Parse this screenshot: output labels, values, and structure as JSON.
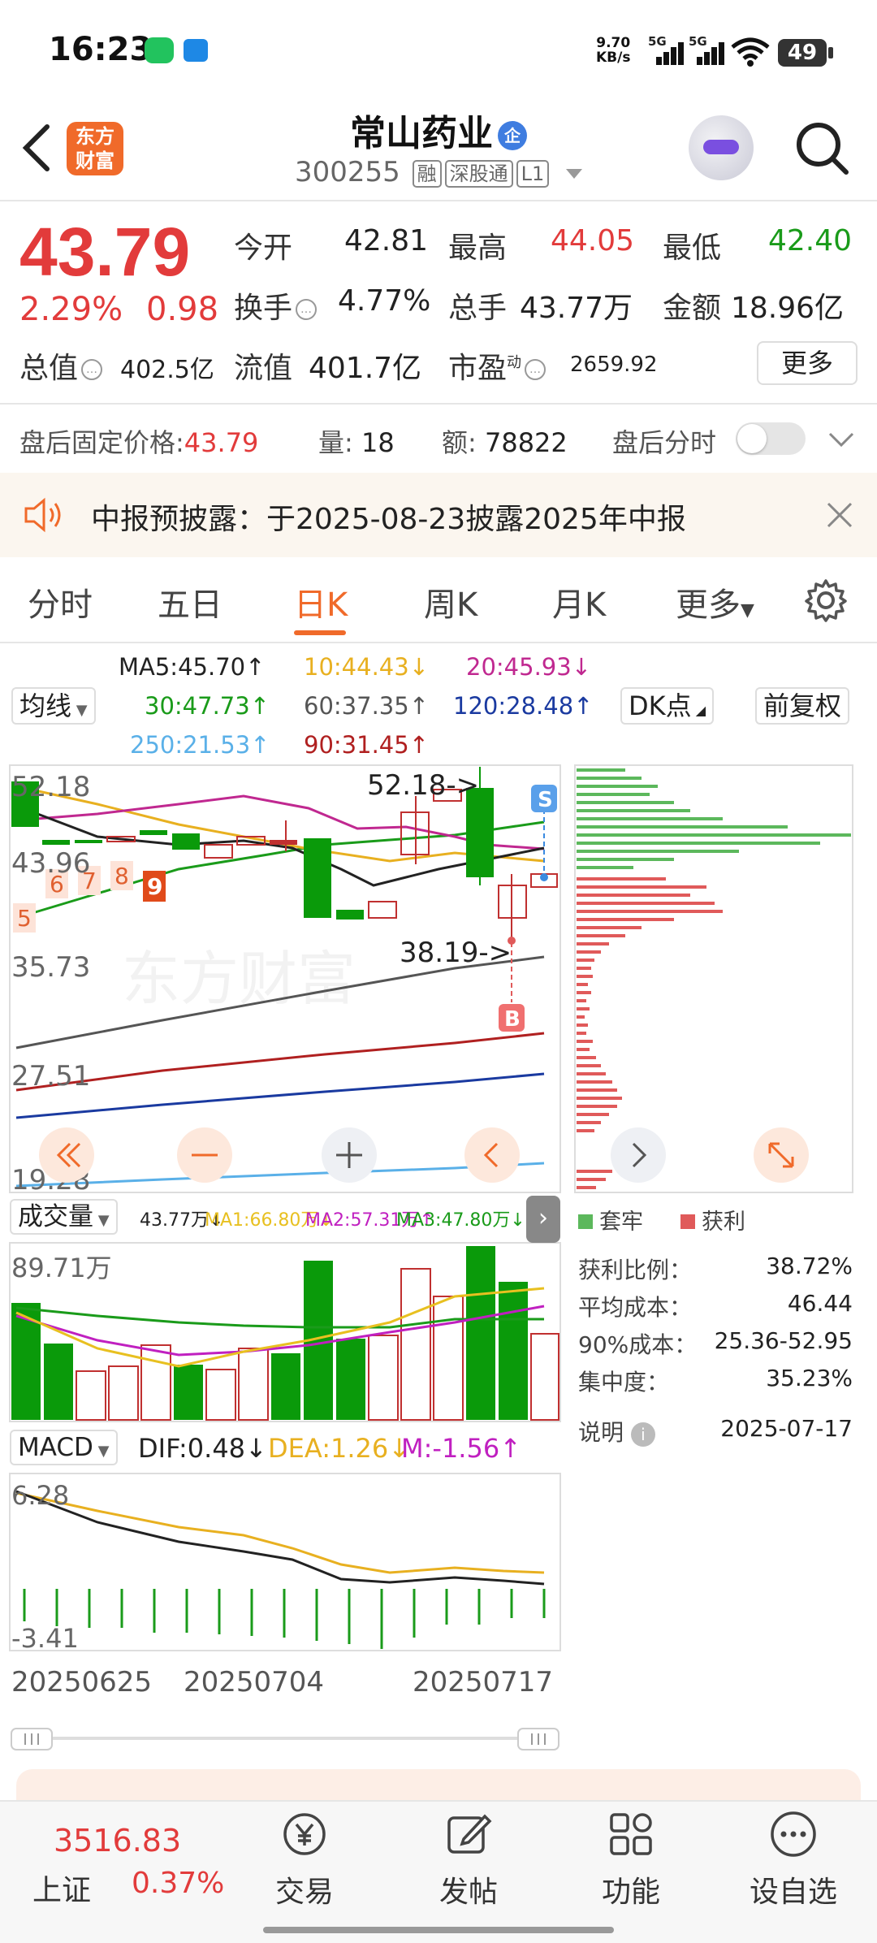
{
  "status_bar": {
    "time": "16:23",
    "net_speed_value": "9.70",
    "net_speed_unit": "KB/s",
    "sim1": "5G",
    "sim2": "5G",
    "battery": "49"
  },
  "header": {
    "logo_text_line1": "东方",
    "logo_text_line2": "财富",
    "stock_name": "常山药业",
    "name_badge": "企",
    "stock_code": "300255",
    "tags": [
      "融",
      "深股通",
      "L1"
    ]
  },
  "quote": {
    "price": "43.79",
    "change_pct": "2.29%",
    "change_val": "0.98",
    "open_label": "今开",
    "open": "42.81",
    "high_label": "最高",
    "high": "44.05",
    "low_label": "最低",
    "low": "42.40",
    "turnover_label": "换手",
    "turnover": "4.77%",
    "volume_label": "总手",
    "volume": "43.77万",
    "amount_label": "金额",
    "amount": "18.96亿",
    "mktcap_label": "总值",
    "mktcap": "402.5亿",
    "float_label": "流值",
    "float": "401.7亿",
    "pe_label": "市盈",
    "pe_sup": "动",
    "pe": "2659.92",
    "more_button": "更多"
  },
  "after_hours": {
    "price_label": "盘后固定价格:",
    "price": "43.79",
    "qty_label": "量:",
    "qty": "18",
    "amt_label": "额:",
    "amt": "78822",
    "toggle_label": "盘后分时"
  },
  "notice": {
    "text": "中报预披露：于2025-08-23披露2025年中报"
  },
  "tabs": [
    "分时",
    "五日",
    "日K",
    "周K",
    "月K",
    "更多"
  ],
  "active_tab": "日K",
  "ma": {
    "selector": "均线",
    "ma5": "MA5:45.70↑",
    "ma10": "10:44.43↓",
    "ma20": "20:45.93↓",
    "ma30": "30:47.73↑",
    "ma60": "60:37.35↑",
    "ma120": "120:28.48↑",
    "ma250": "250:21.53↑",
    "ma90": "90:31.45↑",
    "dk_button": "DK点",
    "adjust_button": "前复权"
  },
  "kline": {
    "y_labels": [
      "52.18",
      "43.96",
      "35.73",
      "27.51",
      "19.28"
    ],
    "high_note": "52.18->",
    "low_note": "38.19->",
    "sell_marker": "S",
    "buy_marker": "B",
    "td_counts": [
      "5",
      "6",
      "7",
      "8",
      "9"
    ],
    "watermark": "东方财富"
  },
  "chips": {
    "legend_locked": "套牢",
    "legend_profit": "获利",
    "profit_ratio_label": "获利比例：",
    "profit_ratio": "38.72%",
    "avg_cost_label": "平均成本：",
    "avg_cost": "46.44",
    "cost90_label": "90%成本：",
    "cost90": "25.36-52.95",
    "concentration_label": "集中度：",
    "concentration": "35.23%",
    "note_label": "说明",
    "date": "2025-07-17"
  },
  "volume": {
    "selector": "成交量",
    "vol": "43.77万↓",
    "ma1": "MA1:66.80万↓",
    "ma2": "MA2:57.31万↑",
    "ma3": "MA3:47.80万↓",
    "y_top": "89.71万"
  },
  "macd": {
    "selector": "MACD",
    "dif": "DIF:0.48↓",
    "dea": "DEA:1.26↓",
    "m": "M:-1.56↑",
    "y_top": "6.28",
    "y_bottom": "-3.41",
    "dates": [
      "20250625",
      "20250704",
      "20250717"
    ]
  },
  "bottom_nav": {
    "index_value": "3516.83",
    "index_name": "上证",
    "index_pct": "0.37%",
    "items": [
      "交易",
      "发帖",
      "功能",
      "设自选"
    ]
  }
}
